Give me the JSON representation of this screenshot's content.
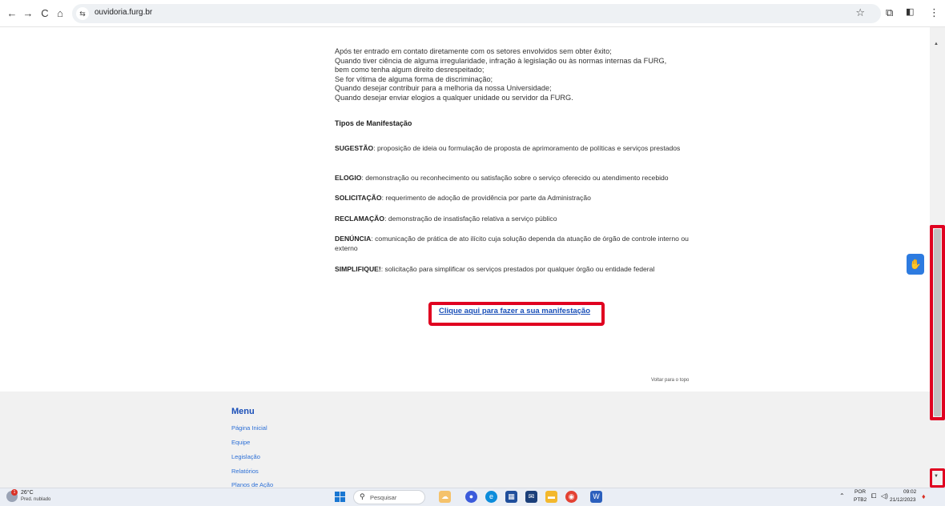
{
  "browser": {
    "url": "ouvidoria.furg.br",
    "back": "←",
    "forward": "→",
    "reload": "C",
    "home": "⌂"
  },
  "content": {
    "intro_lines": [
      "Após ter entrado em contato diretamente com os setores envolvidos sem obter êxito;",
      "Quando tiver ciência de alguma irregularidade, infração à legislação ou às normas internas da FURG,",
      "bem como tenha algum direito desrespeitado;",
      "Se for vítima de alguma forma de discriminação;",
      "Quando desejar contribuir para a melhoria da nossa Universidade;",
      "Quando desejar enviar elogios a qualquer unidade ou servidor da FURG."
    ],
    "tipos_title": "Tipos de Manifestação",
    "tipos": [
      {
        "term": "SUGESTÃO",
        "desc": ": proposição de ideia ou formulação de proposta de aprimoramento de políticas e serviços prestados"
      },
      {
        "term": "ELOGIO",
        "desc": ": demonstração ou reconhecimento ou satisfação sobre o serviço oferecido ou atendimento recebido"
      },
      {
        "term": "SOLICITAÇÃO",
        "desc": ": requerimento de adoção de providência por parte da Administração"
      },
      {
        "term": "RECLAMAÇÃO",
        "desc": ": demonstração de insatisfação relativa a serviço público"
      },
      {
        "term": "DENÚNCIA",
        "desc": ": comunicação de prática de ato ilícito cuja solução dependa da atuação de órgão de controle interno ou externo"
      },
      {
        "term": "SIMPLIFIQUE!",
        "desc": ": solicitação para simplificar os serviços prestados por qualquer órgão ou entidade federal"
      }
    ],
    "cta_link": "Clique aqui para fazer a sua manifestação",
    "back_to_top": "Voltar para o topo"
  },
  "footer": {
    "menu_title": "Menu",
    "items": [
      "Página Inicial",
      "Equipe",
      "Legislação",
      "Relatórios",
      "Planos de Ação"
    ]
  },
  "taskbar": {
    "temp": "26°C",
    "weather": "Pred. nublado",
    "weather_badge": "1",
    "search_placeholder": "Pesquisar",
    "lang_line1": "POR",
    "lang_line2": "PTB2",
    "time": "09:02",
    "date": "21/12/2023"
  },
  "colors": {
    "highlight": "#e00020",
    "link": "#1a4fb8",
    "vlibras": "#2d7be0"
  }
}
